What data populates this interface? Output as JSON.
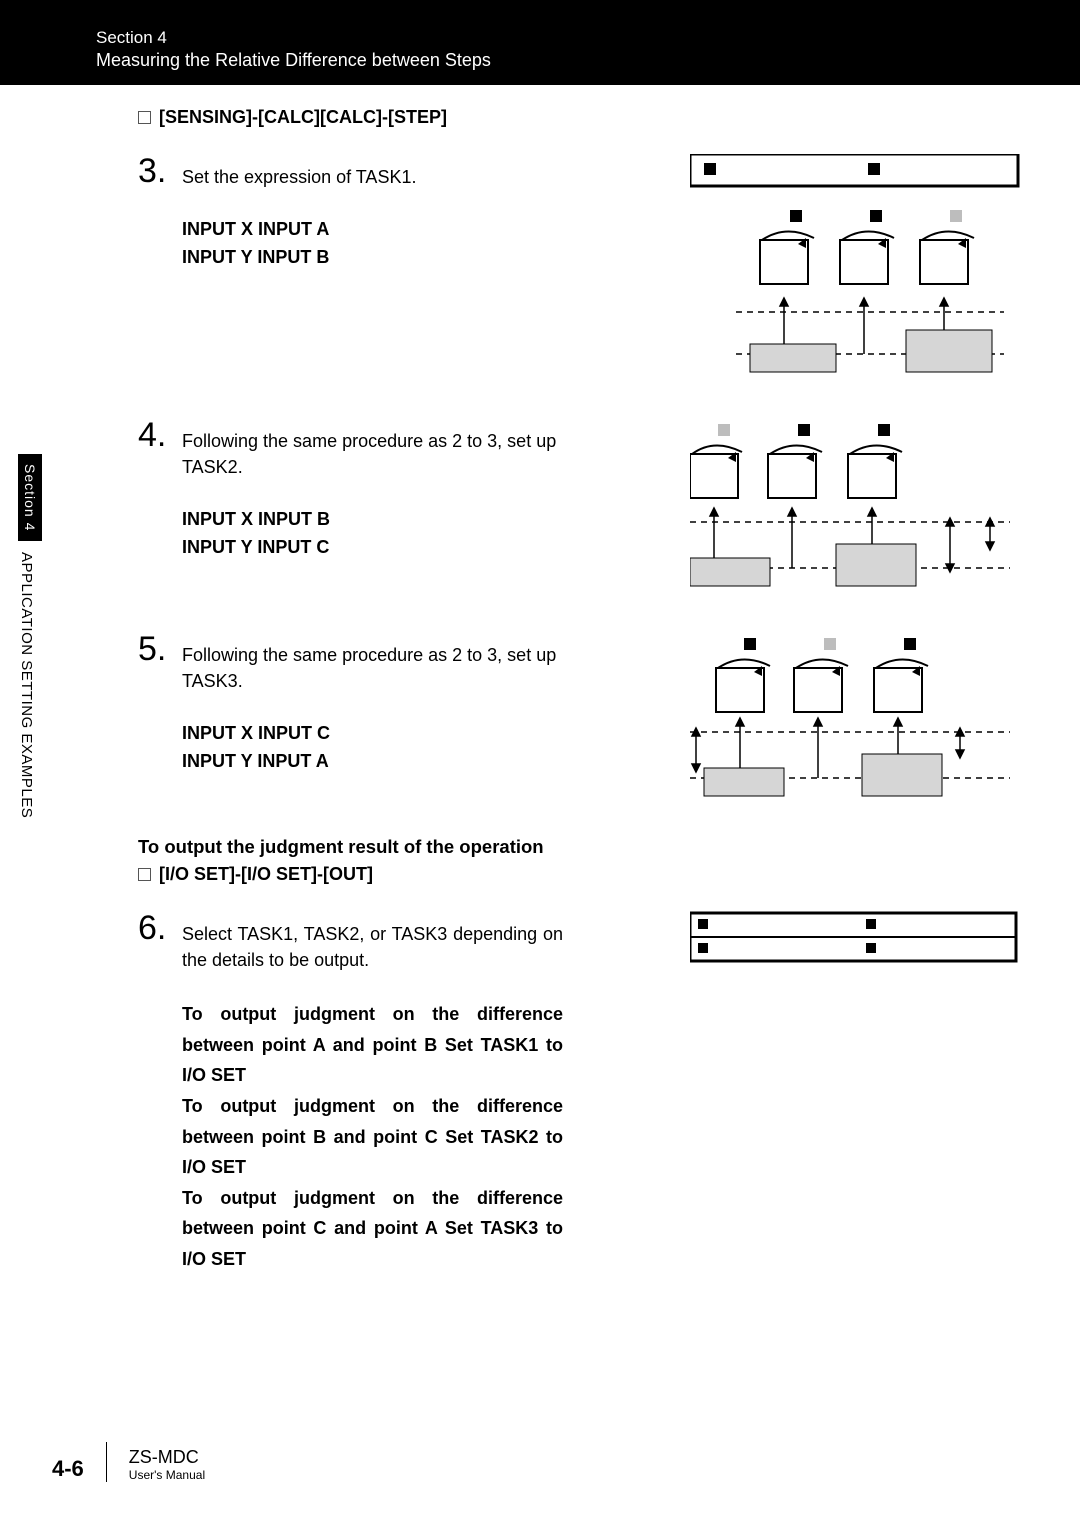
{
  "header": {
    "section": "Section 4",
    "title": "Measuring the Relative Difference between Steps"
  },
  "nav_path_1": "[SENSING]-[CALC][CALC]-[STEP]",
  "steps": {
    "s3": {
      "num": "3.",
      "text": "Set the expression of TASK1.",
      "boldA": "INPUT X INPUT A",
      "boldB": "INPUT Y INPUT B"
    },
    "s4": {
      "num": "4.",
      "text": "Following the same procedure as 2 to 3, set up TASK2.",
      "boldA": "INPUT X INPUT B",
      "boldB": "INPUT Y INPUT C"
    },
    "s5": {
      "num": "5.",
      "text": "Following the same procedure as 2 to 3, set up TASK3.",
      "boldA": "INPUT X INPUT C",
      "boldB": "INPUT Y INPUT A"
    },
    "s6": {
      "num": "6.",
      "text": "Select TASK1, TASK2, or TASK3 depending on the details to be output."
    }
  },
  "output_heading": "To output the judgment result of the operation",
  "nav_path_2": "[I/O SET]-[I/O SET]-[OUT]",
  "output_lines": {
    "l1": "To output judgment on the difference between point A and point B Set TASK1 to I/O SET",
    "l2": "To output judgment on the difference between point B and point C Set TASK2 to I/O SET",
    "l3": "To output judgment on the difference between point C and point A Set TASK3 to I/O SET"
  },
  "sidebar": {
    "tab": "Section 4",
    "label": "APPLICATION SETTING EXAMPLES"
  },
  "footer": {
    "page": "4-6",
    "model": "ZS-MDC",
    "manual": "User's Manual"
  }
}
